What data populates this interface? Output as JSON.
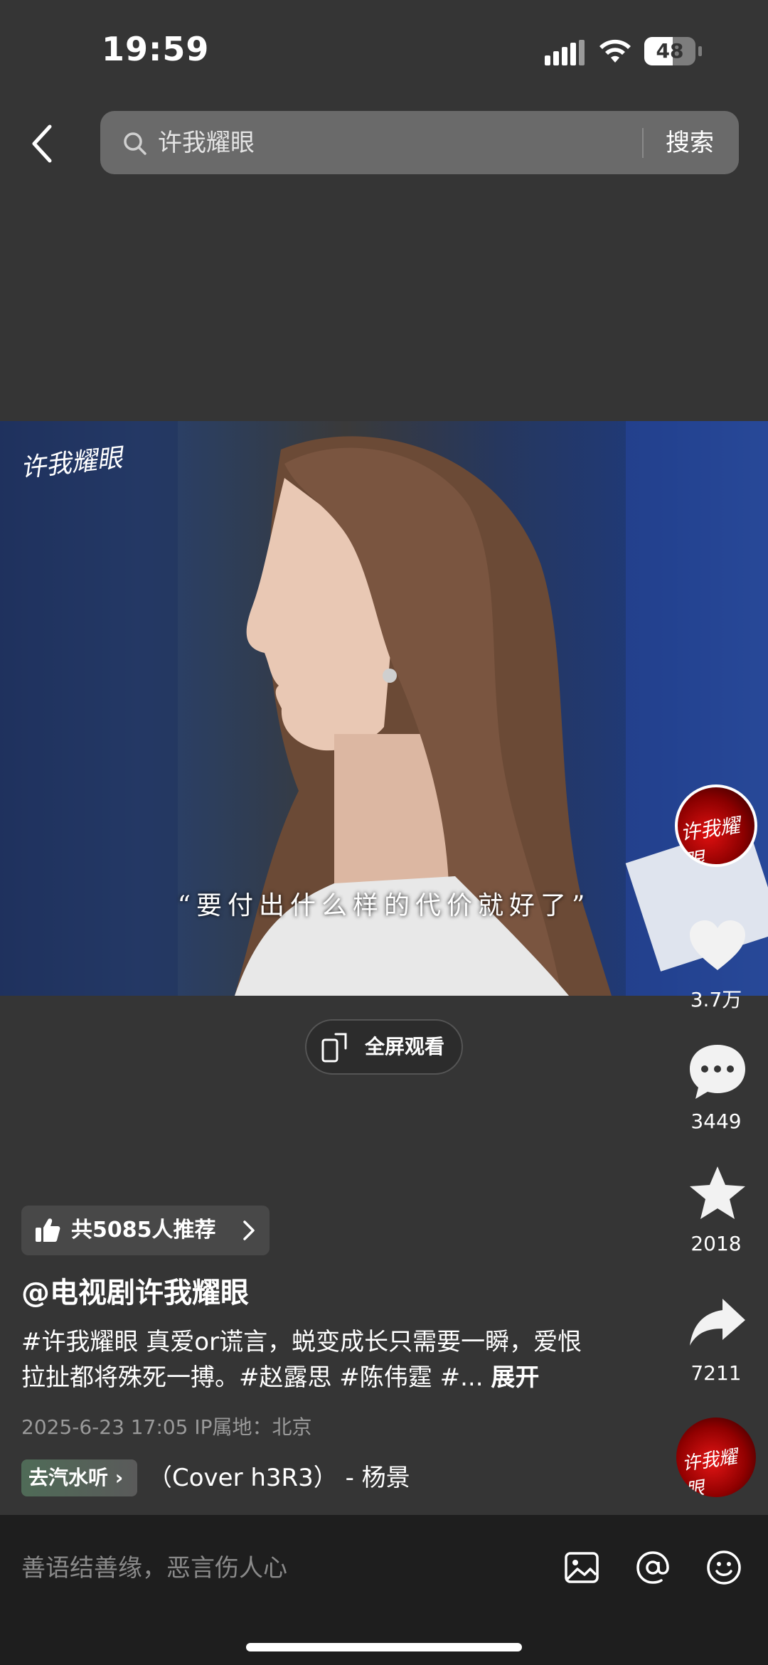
{
  "status_bar": {
    "time": "19:59",
    "battery": "48"
  },
  "search": {
    "query": "许我耀眼",
    "button_label": "搜索"
  },
  "video": {
    "logo_text": "许我耀眼",
    "subtitle": "“要付出什么样的代价就好了”",
    "fullscreen_label": "全屏观看"
  },
  "actions": {
    "avatar_text": "许我耀眼",
    "likes": "3.7万",
    "comments": "3449",
    "favorites": "2018",
    "shares": "7211"
  },
  "post": {
    "recommend_label": "共5085人推荐",
    "author": "@电视剧许我耀眼",
    "description": "#许我耀眼 真爱or谎言，蜕变成长只需要一瞬，爱恨拉扯都将殊死一搏。#赵露思 #陈伟霆 #...",
    "expand_label": "展开",
    "meta": "2025-6-23 17:05  IP属地：北京",
    "music_chip_label": "去汽水听",
    "music_title": "（Cover h3R3） - 杨景",
    "music_disc_text": "许我耀眼"
  },
  "comment_bar": {
    "placeholder": "善语结善缘，恶言伤人心"
  },
  "colors": {
    "background": "#353535",
    "comment_bar": "#1e1e1e",
    "accent_red": "#e01010"
  },
  "icons": [
    "back-icon",
    "search-icon",
    "fullscreen-icon",
    "heart-icon",
    "comment-icon",
    "star-icon",
    "share-icon",
    "thumb-up-icon",
    "image-icon",
    "at-icon",
    "emoji-icon"
  ]
}
